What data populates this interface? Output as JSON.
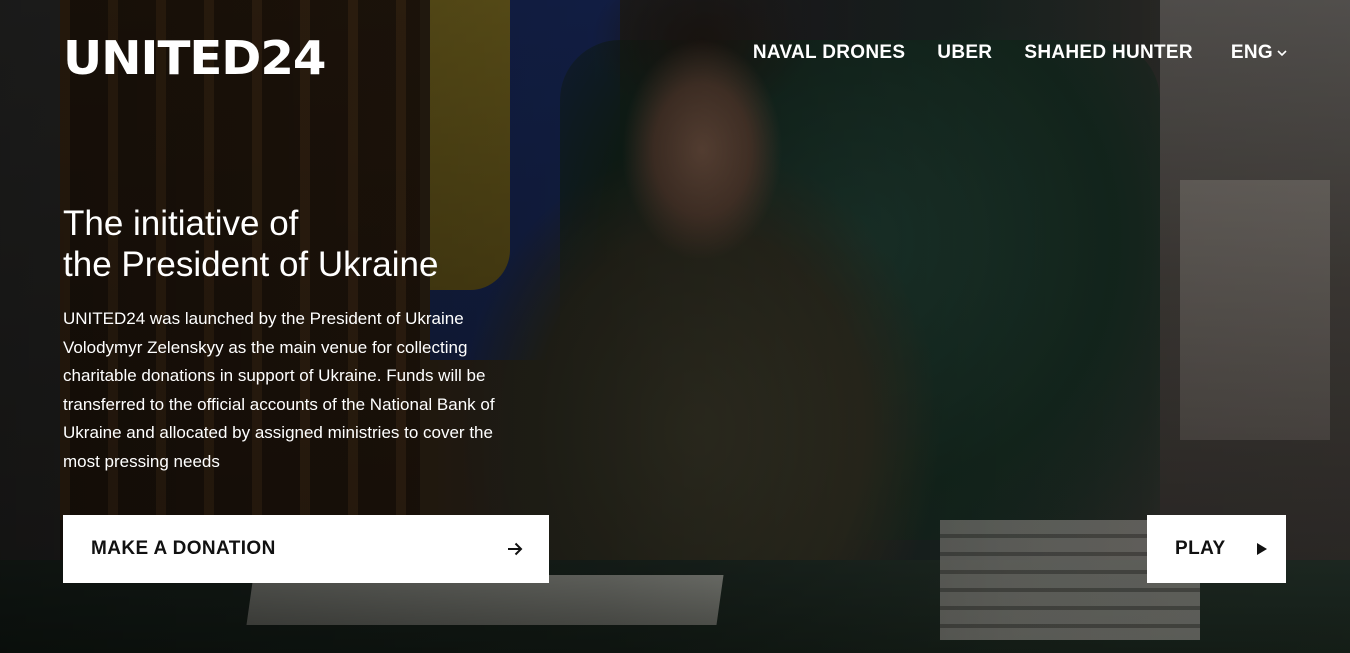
{
  "header": {
    "logo": "UNITED24",
    "nav": [
      {
        "label": "NAVAL DRONES"
      },
      {
        "label": "UBER"
      },
      {
        "label": "SHAHED HUNTER"
      }
    ],
    "language": {
      "selected": "ENG",
      "icon": "chevron-down-icon"
    }
  },
  "hero": {
    "title_line1": "The initiative of",
    "title_line2": "the President of Ukraine",
    "description": "UNITED24 was launched by the President of Ukraine Volodymyr Zelenskyy as the main venue for collecting charitable donations in support of Ukraine. Funds will be transferred to the official accounts of the National Bank of Ukraine and allocated by assigned ministries to cover the most pressing needs",
    "donate_button": {
      "label": "MAKE A DONATION",
      "icon": "arrow-right-icon"
    },
    "play_button": {
      "label": "PLAY",
      "icon": "play-icon"
    }
  },
  "colors": {
    "text": "#ffffff",
    "button_bg": "#ffffff",
    "button_text": "#111111"
  }
}
